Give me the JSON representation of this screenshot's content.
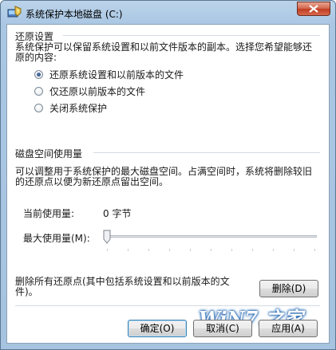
{
  "window": {
    "title": "系统保护本地磁盘 (C:)",
    "icon": "system-protection-icon"
  },
  "restore_settings": {
    "header": "还原设置",
    "description": "系统保护可以保留系统设置和以前文件版本的副本。选择您希望能够还原的内容:",
    "options": [
      {
        "label": "还原系统设置和以前版本的文件",
        "checked": true
      },
      {
        "label": "仅还原以前版本的文件",
        "checked": false
      },
      {
        "label": "关闭系统保护",
        "checked": false
      }
    ]
  },
  "disk_usage": {
    "header": "磁盘空间使用量",
    "description": "可以调整用于系统保护的最大磁盘空间。占满空间时，系统将删除较旧的还原点以便为新还原点留出空间。",
    "current_label": "当前使用量:",
    "current_value": "0 字节",
    "max_label": "最大使用量(M):",
    "max_value_fraction": 0.0
  },
  "delete": {
    "description": "删除所有还原点(其中包括系统设置和以前版本的文件)。",
    "button": "删除(D)"
  },
  "watermark": {
    "text": "WiN7.之家"
  },
  "buttons": {
    "ok": "确定(O)",
    "cancel": "取消(C)",
    "apply": "应用(A)"
  },
  "colors": {
    "title_bar": "#a9c6e3",
    "close_button": "#c03d24",
    "default_button_border": "#3c7fb1"
  }
}
